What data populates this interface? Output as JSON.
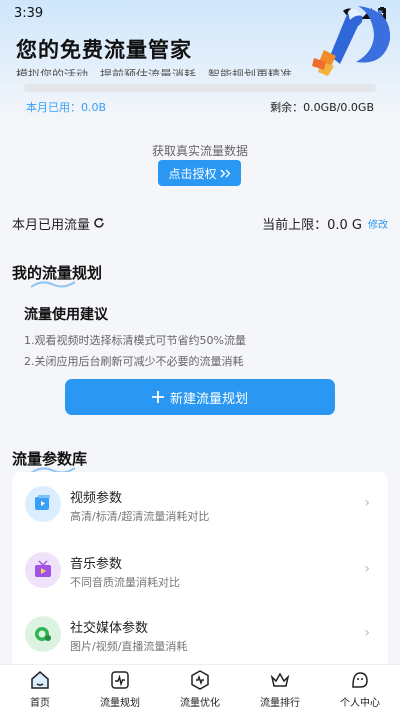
{
  "status_bar": {
    "time": "3:39"
  },
  "hero": {
    "title": "您的免费流量管家",
    "ticker": "模拟您的活动，提前预估流量消耗，智能规划更精准"
  },
  "usage": {
    "used_text": "本月已用：0.0B",
    "remain_text": "剩余：0.0GB/0.0GB",
    "progress": 0
  },
  "auth": {
    "label": "获取真实流量数据",
    "button_label": "点击授权"
  },
  "monthly": {
    "used_label": "本月已用流量",
    "limit_label": "当前上限：0.0 G",
    "edit_label": "修改"
  },
  "plan_section": {
    "title": "我的流量规划",
    "advice_title": "流量使用建议",
    "advice_lines": [
      "1.观看视频时选择标清模式可节省约50%流量",
      "2.关闭应用后台刷新可减少不必要的流量消耗"
    ],
    "new_plan_label": "新建流量规划"
  },
  "library": {
    "title": "流量参数库",
    "items": [
      {
        "name": "视频参数",
        "desc": "高清/标清/超清流量消耗对比",
        "icon": "video-icon",
        "color": "#3b9ff5"
      },
      {
        "name": "音乐参数",
        "desc": "不同音质流量消耗对比",
        "icon": "music-tv-icon",
        "color": "#a052e8"
      },
      {
        "name": "社交媒体参数",
        "desc": "图片/视频/直播流量消耗",
        "icon": "social-icon",
        "color": "#2fb552"
      }
    ]
  },
  "tabs": [
    {
      "label": "首页",
      "icon": "home-icon"
    },
    {
      "label": "流量规划",
      "icon": "chart-icon"
    },
    {
      "label": "流量优化",
      "icon": "gauge-icon"
    },
    {
      "label": "流量排行",
      "icon": "crown-icon"
    },
    {
      "label": "个人中心",
      "icon": "person-icon"
    }
  ],
  "colors": {
    "accent": "#2a98f3",
    "background": "#f4f6f9"
  }
}
